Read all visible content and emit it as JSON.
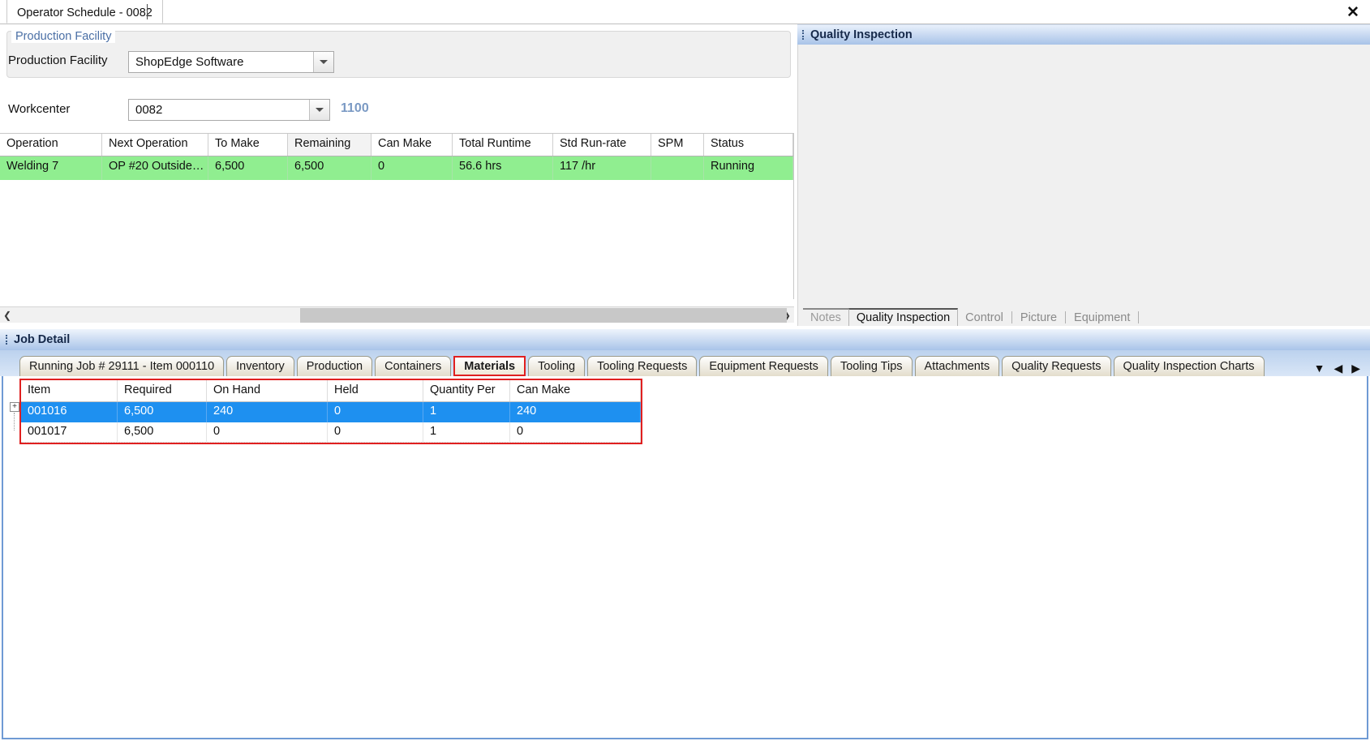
{
  "window": {
    "tab_label": "Operator Schedule - 0082",
    "close_icon": "close-icon"
  },
  "production_facility_group": {
    "title": "Production Facility",
    "facility_label": "Production Facility",
    "facility_value": "ShopEdge Software",
    "workcenter_label": "Workcenter",
    "workcenter_value": "0082",
    "workcenter_code": "1100"
  },
  "operation_grid": {
    "columns": [
      "Operation",
      "Next Operation",
      "To Make",
      "Remaining",
      "Can Make",
      "Total Runtime",
      "Std Run-rate",
      "SPM",
      "Status"
    ],
    "rows": [
      {
        "operation": "Welding 7",
        "next_operation": "OP #20  Outside…",
        "to_make": "6,500",
        "remaining": "6,500",
        "can_make": "0",
        "total_runtime": "56.6 hrs",
        "std_run_rate": "117 /hr",
        "spm": "",
        "status": "Running"
      }
    ],
    "row_highlight_color": "#90ee90",
    "scroll_left_icon": "chevron-left-icon",
    "scroll_right_icon": "chevron-right-icon"
  },
  "quality_inspection_panel": {
    "caption": "Quality Inspection",
    "tabs": [
      {
        "label": "Notes",
        "active": false
      },
      {
        "label": "Quality Inspection",
        "active": true
      },
      {
        "label": "Control",
        "active": false
      },
      {
        "label": "Picture",
        "active": false
      },
      {
        "label": "Equipment",
        "active": false
      }
    ]
  },
  "job_detail": {
    "caption": "Job Detail",
    "tabs": [
      {
        "label": "Running Job # 29111 - Item 000110",
        "active": false
      },
      {
        "label": "Inventory",
        "active": false
      },
      {
        "label": "Production",
        "active": false
      },
      {
        "label": "Containers",
        "active": false
      },
      {
        "label": "Materials",
        "active": true
      },
      {
        "label": "Tooling",
        "active": false
      },
      {
        "label": "Tooling Requests",
        "active": false
      },
      {
        "label": "Equipment Requests",
        "active": false
      },
      {
        "label": "Tooling Tips",
        "active": false
      },
      {
        "label": "Attachments",
        "active": false
      },
      {
        "label": "Quality Requests",
        "active": false
      },
      {
        "label": "Quality Inspection Charts",
        "active": false
      }
    ],
    "nav": {
      "dropdown_icon": "chevron-down-icon",
      "prev_icon": "triangle-left-icon",
      "next_icon": "triangle-right-icon"
    }
  },
  "materials_grid": {
    "columns": [
      "Item",
      "Required",
      "On Hand",
      "Held",
      "Quantity Per",
      "Can Make"
    ],
    "rows": [
      {
        "item": "001016",
        "required": "6,500",
        "on_hand": "240",
        "held": "0",
        "quantity_per": "1",
        "can_make": "240",
        "selected": true
      },
      {
        "item": "001017",
        "required": "6,500",
        "on_hand": "0",
        "held": "0",
        "quantity_per": "1",
        "can_make": "0",
        "selected": false
      }
    ],
    "expander_glyph": "+",
    "selection_color": "#1e90f0",
    "highlight_border_color": "#e02020"
  }
}
